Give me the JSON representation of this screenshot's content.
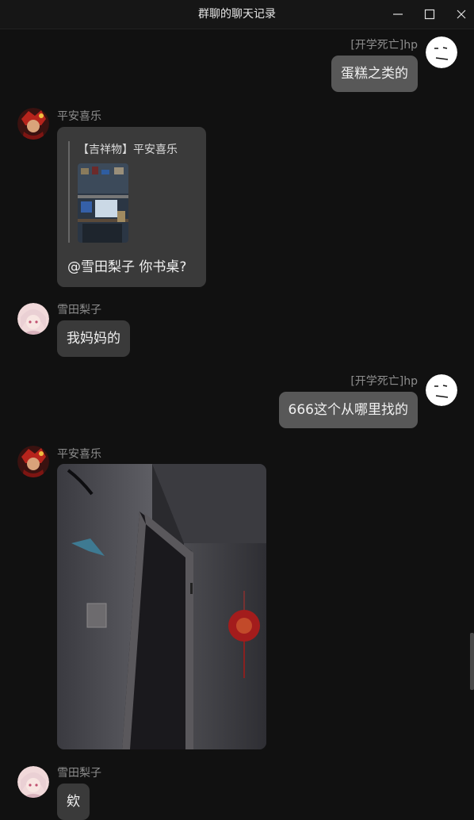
{
  "window": {
    "title": "群聊的聊天记录",
    "controls": [
      "minimize-icon",
      "maximize-icon",
      "close-icon"
    ]
  },
  "messages": [
    {
      "sender": "[开学死亡]hp",
      "side": "right",
      "text": "蛋糕之类的"
    },
    {
      "sender": "平安喜乐",
      "side": "left",
      "quote": {
        "sender": "【吉祥物】平安喜乐",
        "thumbnail": "desk-photo"
      },
      "text": "@雪田梨子 你书桌?"
    },
    {
      "sender": "雪田梨子",
      "side": "left",
      "text": "我妈妈的"
    },
    {
      "sender": "[开学死亡]hp",
      "side": "right",
      "text": "666这个从哪里找的"
    },
    {
      "sender": "平安喜乐",
      "side": "left",
      "image": "room-photo"
    },
    {
      "sender": "雪田梨子",
      "side": "left",
      "text": "欸"
    }
  ],
  "colors": {
    "background": "#111111",
    "bubble_left": "#3a3a3a",
    "bubble_right": "#585858",
    "sender_name": "#8d8d8d"
  }
}
